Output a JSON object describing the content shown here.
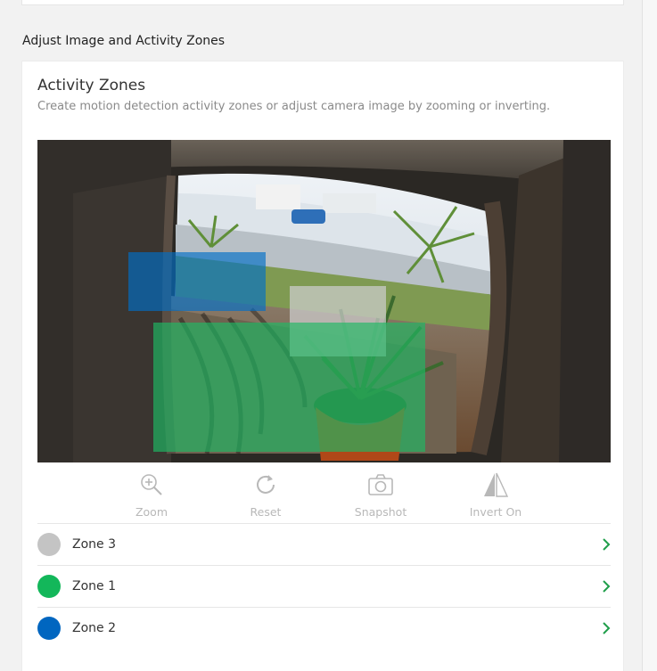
{
  "section_title": "Adjust Image and Activity Zones",
  "card": {
    "title": "Activity Zones",
    "description": "Create motion detection activity zones or adjust camera image by zooming or inverting."
  },
  "camera_zones": [
    {
      "name": "Zone 2",
      "color": "#0066c0"
    },
    {
      "name": "Zone 3",
      "color": "#c8c8c8"
    },
    {
      "name": "Zone 1",
      "color": "#1bb35f"
    }
  ],
  "toolbar": {
    "zoom_label": "Zoom",
    "reset_label": "Reset",
    "snapshot_label": "Snapshot",
    "invert_label": "Invert On",
    "icon_color": "#b8b8b8"
  },
  "zones": [
    {
      "name": "Zone 3",
      "color": "#c4c4c4"
    },
    {
      "name": "Zone 1",
      "color": "#13b75a"
    },
    {
      "name": "Zone 2",
      "color": "#0066c0"
    }
  ],
  "accent_color": "#1f9e4a"
}
